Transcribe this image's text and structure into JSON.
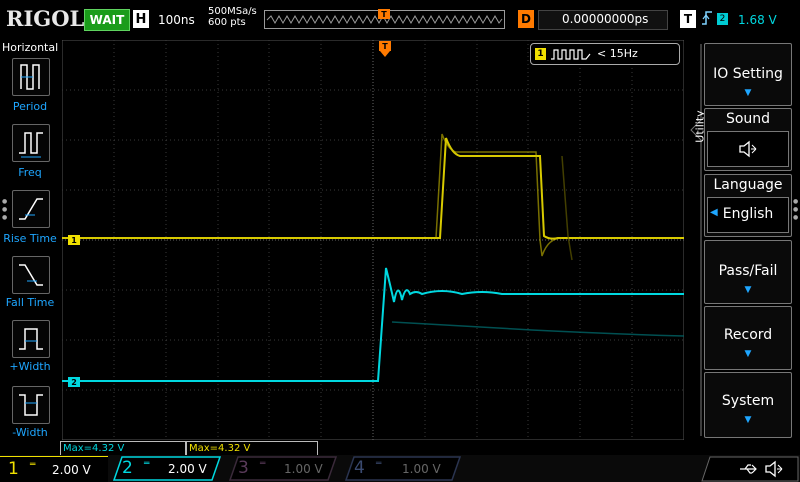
{
  "topbar": {
    "logo": "RIGOL",
    "run_status": "WAIT",
    "timebase_badge": "H",
    "timebase": "100ns",
    "sample_rate": "500MSa/s",
    "memory_depth": "600 pts",
    "trigger_position_marker": "T",
    "delay_badge": "D",
    "delay": "0.00000000ps",
    "trigger_badge": "T",
    "trigger_source": "2",
    "trigger_level": "1.68 V"
  },
  "left_panel": {
    "title": "Horizontal",
    "items": [
      {
        "label": "Period",
        "icon": "period-icon"
      },
      {
        "label": "Freq",
        "icon": "frequency-icon"
      },
      {
        "label": "Rise Time",
        "icon": "rise-time-icon"
      },
      {
        "label": "Fall Time",
        "icon": "fall-time-icon"
      },
      {
        "label": "+Width",
        "icon": "positive-width-icon"
      },
      {
        "label": "-Width",
        "icon": "negative-width-icon"
      }
    ]
  },
  "screen": {
    "frequency_badge": "1",
    "frequency_readout": "< 15Hz",
    "ch1_marker": "1",
    "ch2_marker": "2",
    "top_trigger_marker": "T",
    "side_trigger_marker": "T"
  },
  "measurements": [
    {
      "text": "Max=4.32 V",
      "color": "#00d8e0"
    },
    {
      "text": "Max=4.32 V",
      "color": "#f0e000"
    }
  ],
  "right_panel": {
    "menu_title": "Utility",
    "items": [
      {
        "label": "IO Setting",
        "type": "submenu"
      },
      {
        "label": "Sound",
        "type": "toggle",
        "icon": "speaker-icon"
      },
      {
        "label": "Language",
        "type": "select",
        "value": "English"
      },
      {
        "label": "Pass/Fail",
        "type": "submenu"
      },
      {
        "label": "Record",
        "type": "submenu"
      },
      {
        "label": "System",
        "type": "submenu"
      }
    ]
  },
  "channels": [
    {
      "number": "1",
      "scale": "2.00 V",
      "color": "#f0e000",
      "active": true
    },
    {
      "number": "2",
      "scale": "2.00 V",
      "color": "#00d8e0",
      "active": true
    },
    {
      "number": "3",
      "scale": "1.00 V",
      "color": "#c000c0",
      "active": false
    },
    {
      "number": "4",
      "scale": "1.00 V",
      "color": "#3a6cff",
      "active": false
    }
  ],
  "status_icons": [
    "usb-icon",
    "speaker-icon"
  ],
  "colors": {
    "ch1": "#f0e000",
    "ch2": "#00d8e0",
    "accent": "#1ea6ff",
    "trigger": "#ff7a00",
    "run_status": "#1a9c1a"
  }
}
